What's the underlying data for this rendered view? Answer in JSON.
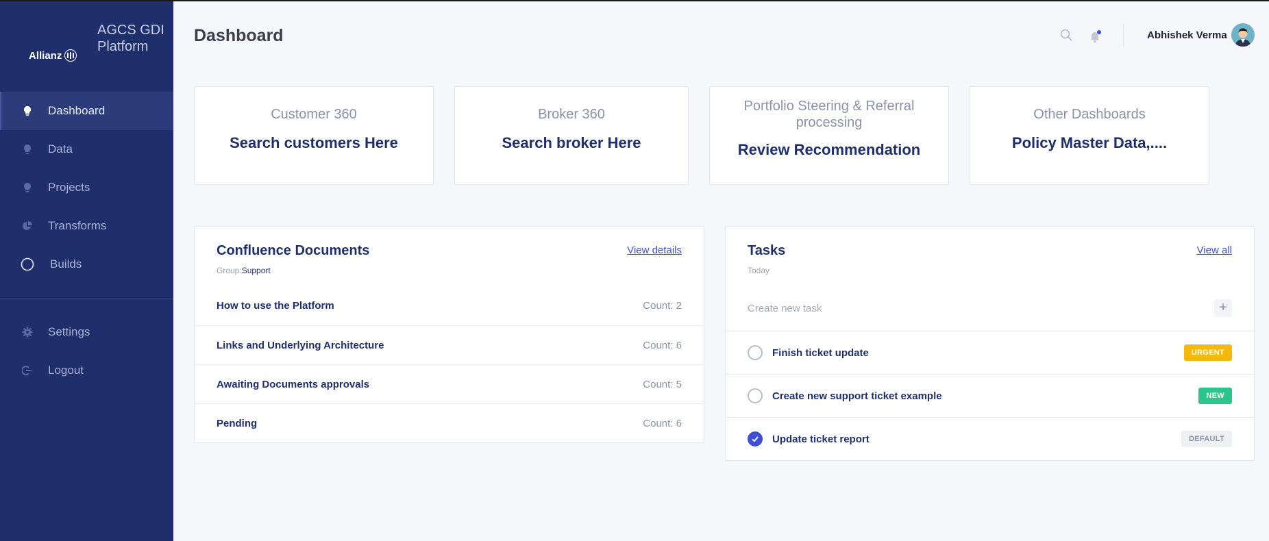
{
  "sidebar": {
    "brand_logo": "Allianz",
    "brand_title": "AGCS GDI Platform",
    "items": [
      {
        "label": "Dashboard",
        "icon": "bulb-icon"
      },
      {
        "label": "Data",
        "icon": "bulb-icon"
      },
      {
        "label": "Projects",
        "icon": "bulb-icon"
      },
      {
        "label": "Transforms",
        "icon": "pie-chart-icon"
      },
      {
        "label": "Builds",
        "icon": "circle-icon"
      },
      {
        "label": "Settings",
        "icon": "gear-icon"
      },
      {
        "label": "Logout",
        "icon": "logout-icon"
      }
    ]
  },
  "header": {
    "title": "Dashboard",
    "user_name": "Abhishek Verma"
  },
  "cards": [
    {
      "title": "Customer 360",
      "subtitle": "Search customers Here"
    },
    {
      "title": "Broker 360",
      "subtitle": "Search broker Here"
    },
    {
      "title": "Portfolio Steering & Referral processing",
      "subtitle": "Review Recommendation"
    },
    {
      "title": "Other Dashboards",
      "subtitle": "Policy Master Data,...."
    }
  ],
  "documents": {
    "title": "Confluence Documents",
    "group_label": "Group:",
    "group_value": "Support",
    "link": "View details",
    "rows": [
      {
        "name": "How to use the Platform",
        "count": "Count: 2"
      },
      {
        "name": "Links and Underlying Architecture",
        "count": "Count: 6"
      },
      {
        "name": "Awaiting Documents approvals",
        "count": "Count: 5"
      },
      {
        "name": "Pending",
        "count": "Count: 6"
      }
    ]
  },
  "tasks": {
    "title": "Tasks",
    "subtitle": "Today",
    "link": "View all",
    "create_placeholder": "Create new task",
    "add_symbol": "+",
    "rows": [
      {
        "name": "Finish ticket update",
        "badge": "URGENT",
        "badge_color": "#f6b90a",
        "badge_text_color": "#ffffff",
        "done": false
      },
      {
        "name": "Create new support ticket example",
        "badge": "NEW",
        "badge_color": "#2dc58c",
        "badge_text_color": "#ffffff",
        "done": false
      },
      {
        "name": "Update ticket report",
        "badge": "DEFAULT",
        "badge_color": "#eef0f4",
        "badge_text_color": "#8a92a8",
        "done": true
      }
    ]
  },
  "colors": {
    "sidebar_bg": "#1f2f6b",
    "accent": "#3d4fd6",
    "text_primary": "#1f2f6b"
  }
}
